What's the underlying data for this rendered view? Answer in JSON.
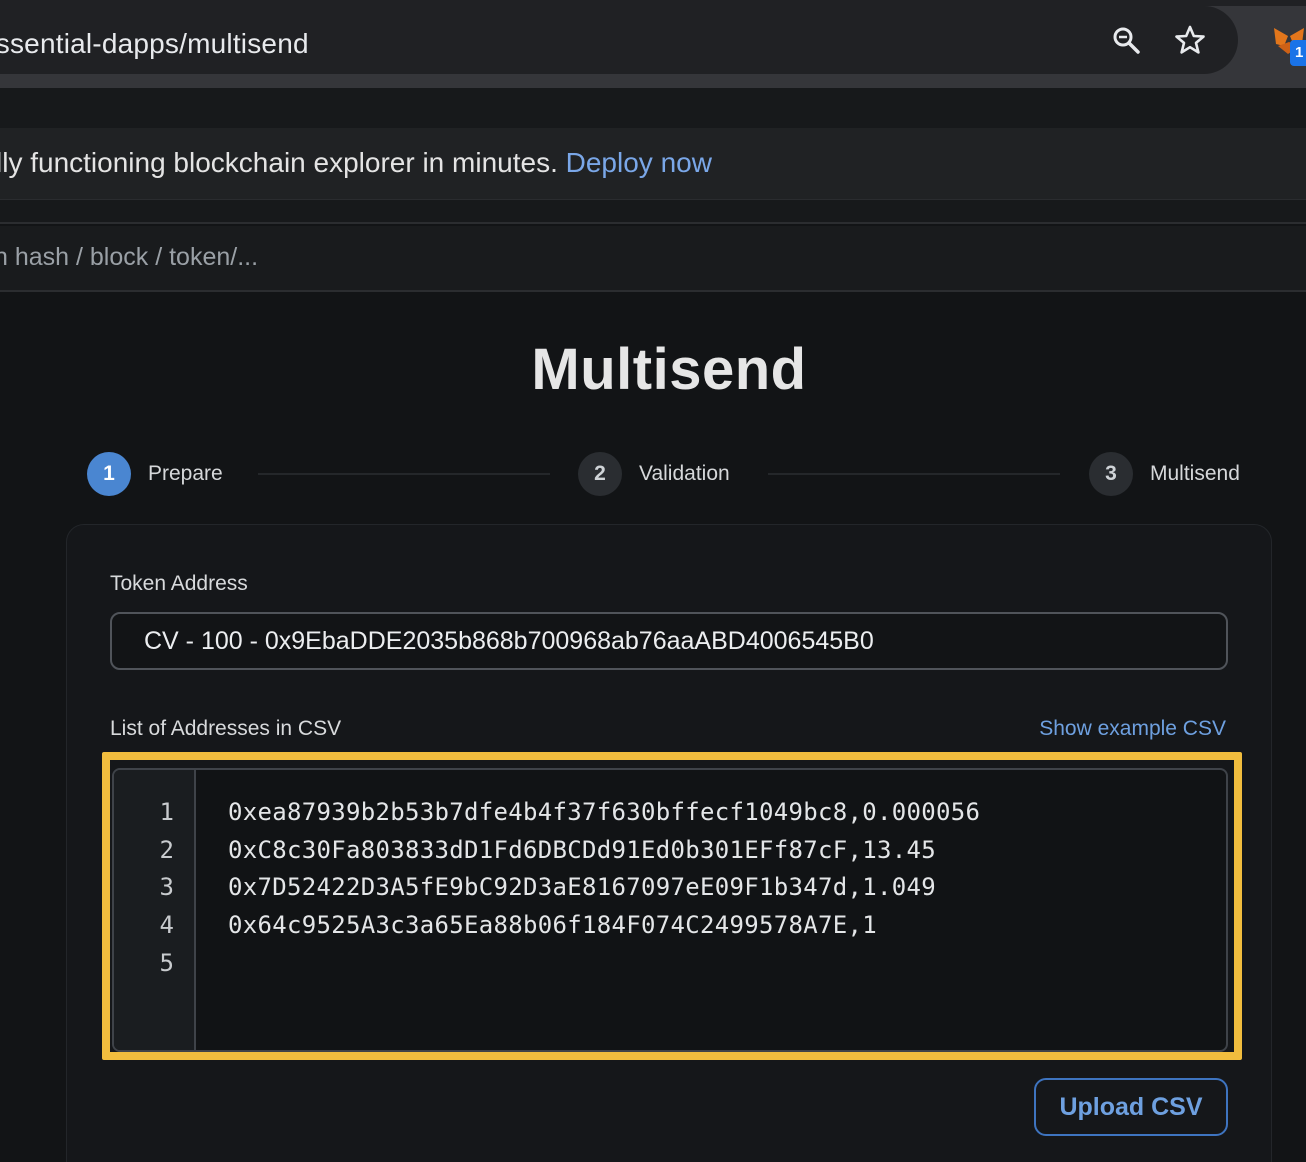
{
  "browser": {
    "url": "essential-dapps/multisend",
    "extension_badge": "1"
  },
  "banner": {
    "text": "lly functioning blockchain explorer in minutes.",
    "link": "Deploy now"
  },
  "search": {
    "placeholder": "n hash / block / token/..."
  },
  "page": {
    "title": "Multisend"
  },
  "stepper": [
    {
      "number": "1",
      "label": "Prepare",
      "state": "active"
    },
    {
      "number": "2",
      "label": "Validation",
      "state": "inactive"
    },
    {
      "number": "3",
      "label": "Multisend",
      "state": "inactive"
    }
  ],
  "form": {
    "token_label": "Token Address",
    "token_value": "CV - 100 - 0x9EbaDDE2035b868b700968ab76aaABD4006545B0",
    "csv_label": "List of Addresses in CSV",
    "show_example": "Show example CSV",
    "csv_lines": [
      {
        "no": "1",
        "text": "0xea87939b2b53b7dfe4b4f37f630bffecf1049bc8,0.000056"
      },
      {
        "no": "2",
        "text": "0xC8c30Fa803833dD1Fd6DBCDd91Ed0b301EFf87cF,13.45"
      },
      {
        "no": "3",
        "text": "0x7D52422D3A5fE9bC92D3aE8167097eE09F1b347d,1.049"
      },
      {
        "no": "4",
        "text": "0x64c9525A3c3a65Ea88b06f184F074C2499578A7E,1"
      },
      {
        "no": "5",
        "text": ""
      }
    ],
    "upload_button": "Upload CSV"
  },
  "colors": {
    "accent": "#4a86d1",
    "link": "#6ea0e0",
    "highlight": "#f1bd3e"
  }
}
